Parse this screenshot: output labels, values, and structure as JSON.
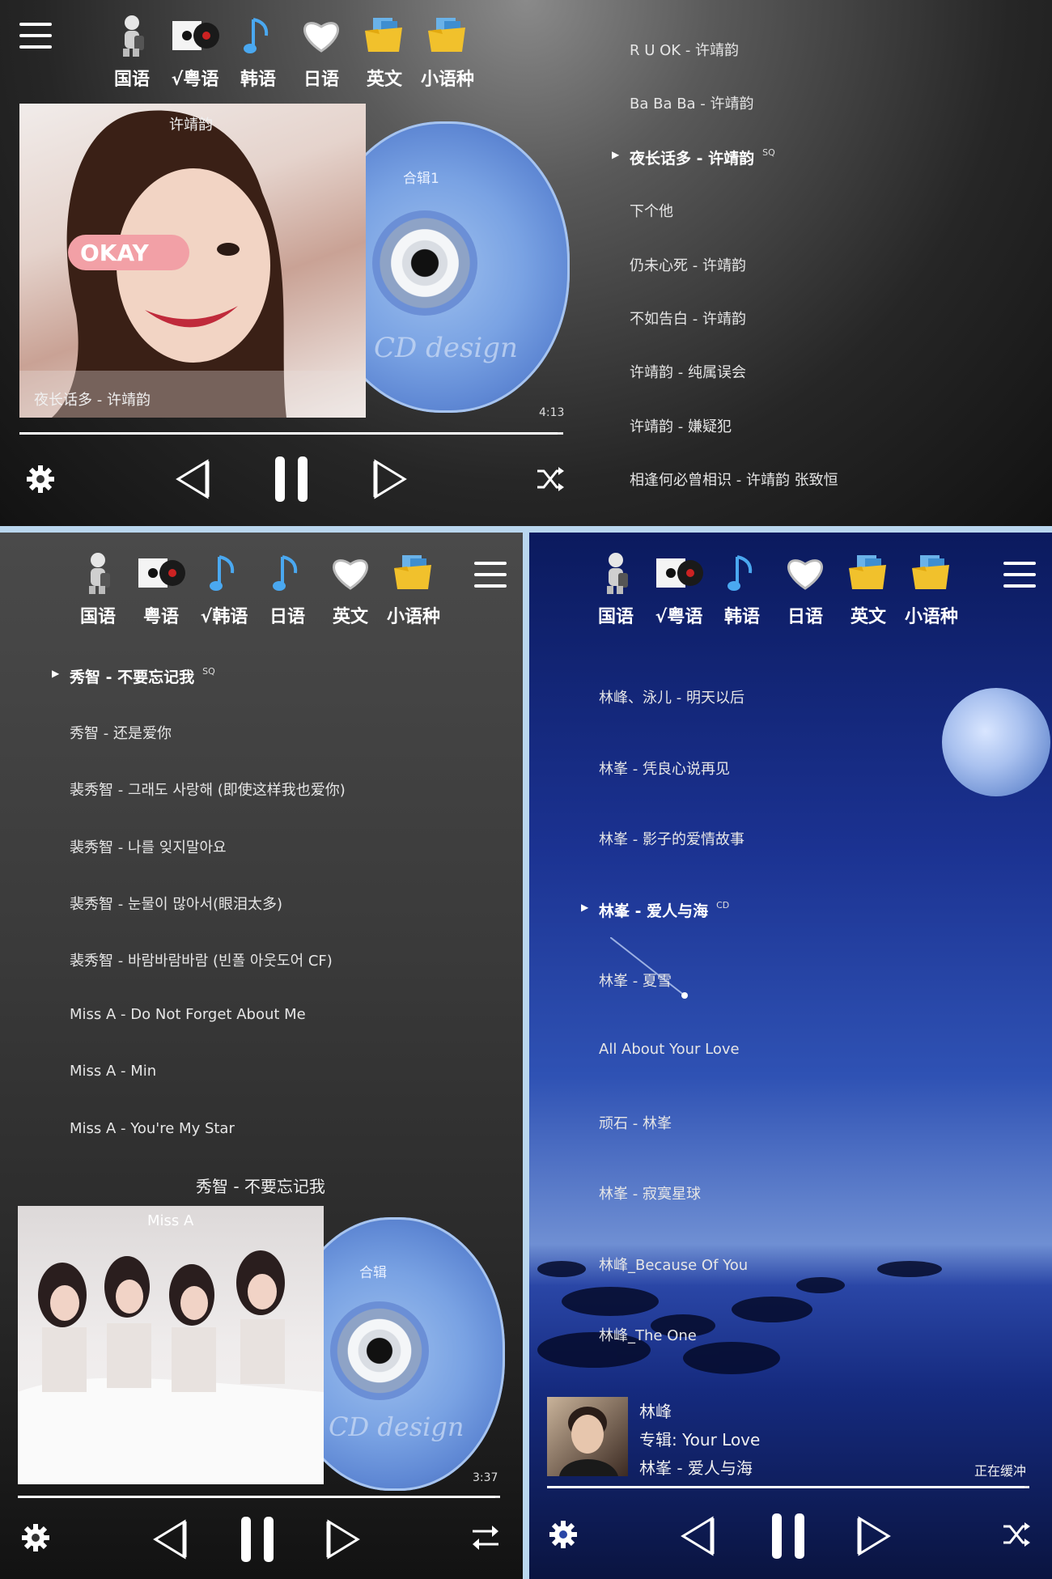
{
  "top": {
    "langs": [
      {
        "label": "国语",
        "icon": "microphone-icon"
      },
      {
        "label": "√粤语",
        "icon": "vinyl-record-icon"
      },
      {
        "label": "韩语",
        "icon": "music-note-icon"
      },
      {
        "label": "日语",
        "icon": "heart-icon"
      },
      {
        "label": "英文",
        "icon": "folder-icon"
      },
      {
        "label": "小语种",
        "icon": "folder-icon"
      }
    ],
    "cover_artist": "许靖韵",
    "cover_overlay_title": "夜长话多 - 许靖韵",
    "cd_title": "合辑1",
    "cd_logo": "CD design",
    "time": "4:13",
    "progress": 0.99,
    "songs": [
      {
        "title": "R U OK - 许靖韵",
        "active": false,
        "quality": ""
      },
      {
        "title": "Ba Ba Ba - 许靖韵",
        "active": false,
        "quality": ""
      },
      {
        "title": "夜长话多 - 许靖韵",
        "active": true,
        "quality": "SQ"
      },
      {
        "title": "下个他",
        "active": false,
        "quality": ""
      },
      {
        "title": "仍未心死 - 许靖韵",
        "active": false,
        "quality": ""
      },
      {
        "title": "不如告白 - 许靖韵",
        "active": false,
        "quality": ""
      },
      {
        "title": "许靖韵 - 纯属误会",
        "active": false,
        "quality": ""
      },
      {
        "title": "许靖韵 - 嫌疑犯",
        "active": false,
        "quality": ""
      },
      {
        "title": "相逢何必曾相识 - 许靖韵 张致恒",
        "active": false,
        "quality": ""
      }
    ]
  },
  "bottom_left": {
    "langs": [
      {
        "label": "国语",
        "icon": "microphone-icon"
      },
      {
        "label": "粤语",
        "icon": "vinyl-record-icon"
      },
      {
        "label": "√韩语",
        "icon": "music-note-icon"
      },
      {
        "label": "日语",
        "icon": "music-note-icon"
      },
      {
        "label": "英文",
        "icon": "heart-icon"
      },
      {
        "label": "小语种",
        "icon": "folder-icon"
      }
    ],
    "now_playing": "秀智 - 不要忘记我",
    "cover_artist": "Miss A",
    "cd_title": "合辑",
    "cd_logo": "CD design",
    "time": "3:37",
    "progress": 0.99,
    "songs": [
      {
        "title": "秀智 - 不要忘记我",
        "active": true,
        "quality": "SQ"
      },
      {
        "title": "秀智 - 还是爱你",
        "active": false,
        "quality": ""
      },
      {
        "title": "裴秀智 - 그래도 사랑해 (即使这样我也爱你)",
        "active": false,
        "quality": ""
      },
      {
        "title": "裴秀智 - 나를 잊지말아요",
        "active": false,
        "quality": ""
      },
      {
        "title": "裴秀智 - 눈물이 많아서(眼泪太多)",
        "active": false,
        "quality": ""
      },
      {
        "title": "裴秀智 - 바람바람바람 (빈폴 아웃도어 CF)",
        "active": false,
        "quality": ""
      },
      {
        "title": "Miss A - Do Not Forget About Me",
        "active": false,
        "quality": ""
      },
      {
        "title": "Miss A - Min",
        "active": false,
        "quality": ""
      },
      {
        "title": "Miss A - You're My Star",
        "active": false,
        "quality": ""
      }
    ]
  },
  "bottom_right": {
    "langs": [
      {
        "label": "国语",
        "icon": "microphone-icon"
      },
      {
        "label": "√粤语",
        "icon": "vinyl-record-icon"
      },
      {
        "label": "韩语",
        "icon": "music-note-icon"
      },
      {
        "label": "日语",
        "icon": "heart-icon"
      },
      {
        "label": "英文",
        "icon": "folder-icon"
      },
      {
        "label": "小语种",
        "icon": "folder-icon"
      }
    ],
    "songs": [
      {
        "title": "林峰、泳儿 - 明天以后",
        "active": false,
        "quality": ""
      },
      {
        "title": "林峯 - 凭良心说再见",
        "active": false,
        "quality": ""
      },
      {
        "title": "林峯 - 影子的爱情故事",
        "active": false,
        "quality": ""
      },
      {
        "title": "林峯 - 爱人与海",
        "active": true,
        "quality": "CD"
      },
      {
        "title": "林峯 - 夏雪",
        "active": false,
        "quality": ""
      },
      {
        "title": "All About Your Love",
        "active": false,
        "quality": ""
      },
      {
        "title": "顽石 - 林峯",
        "active": false,
        "quality": ""
      },
      {
        "title": "林峯 - 寂寞星球",
        "active": false,
        "quality": ""
      },
      {
        "title": "林峰_Because Of You",
        "active": false,
        "quality": ""
      },
      {
        "title": "林峰_The One",
        "active": false,
        "quality": ""
      }
    ],
    "mini": {
      "artist": "林峰",
      "album": "专辑:  Your Love",
      "title": "林峯 - 爱人与海",
      "status": "正在缓冲"
    },
    "progress": 0.99
  }
}
